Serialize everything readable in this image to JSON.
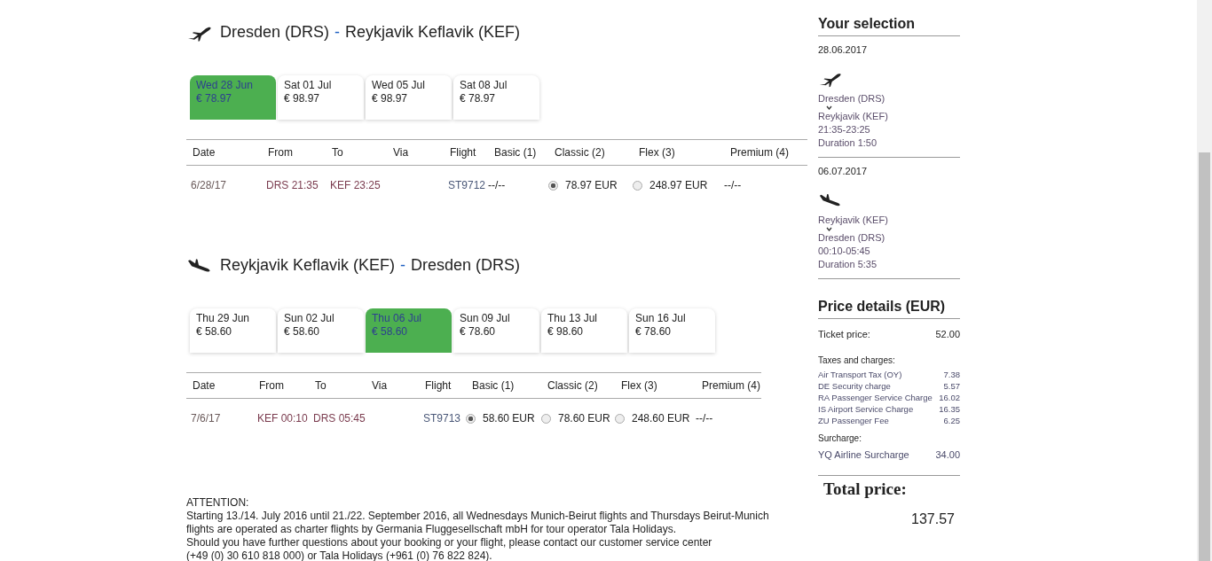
{
  "flights": [
    {
      "kind": "takeoff",
      "title": {
        "from": "Dresden (DRS)",
        "separator": "-",
        "to": "Reykjavik Keflavik (KEF)"
      },
      "dates": [
        {
          "day": "Wed 28 Jun",
          "price": "€ 78.97",
          "selected": true
        },
        {
          "day": "Sat 01 Jul",
          "price": "€ 98.97",
          "selected": false
        },
        {
          "day": "Wed 05 Jul",
          "price": "€ 98.97",
          "selected": false
        },
        {
          "day": "Sat 08 Jul",
          "price": "€ 78.97",
          "selected": false
        }
      ],
      "columns": [
        "Date",
        "From",
        "To",
        "Via",
        "Flight",
        "Basic (1)",
        "Classic (2)",
        "Flex (3)",
        "Premium (4)"
      ],
      "rows": [
        {
          "date": "6/28/17",
          "from": "DRS 21:35",
          "to": "KEF 23:25",
          "flight": "ST9712",
          "fares": [
            {
              "kind": "none",
              "text": "--/--"
            },
            {
              "kind": "radio",
              "price": "78.97 EUR",
              "selected": true
            },
            {
              "kind": "radio",
              "price": "248.97 EUR",
              "selected": false
            },
            {
              "kind": "none",
              "text": "--/--"
            }
          ]
        }
      ]
    },
    {
      "kind": "landing",
      "title": {
        "from": "Reykjavik Keflavik (KEF)",
        "separator": "-",
        "to": "Dresden (DRS)"
      },
      "dates": [
        {
          "day": "Thu 29 Jun",
          "price": "€ 58.60",
          "selected": false
        },
        {
          "day": "Sun 02 Jul",
          "price": "€ 58.60",
          "selected": false
        },
        {
          "day": "Thu 06 Jul",
          "price": "€ 58.60",
          "selected": true
        },
        {
          "day": "Sun 09 Jul",
          "price": "€ 78.60",
          "selected": false
        },
        {
          "day": "Thu 13 Jul",
          "price": "€ 98.60",
          "selected": false
        },
        {
          "day": "Sun 16 Jul",
          "price": "€ 78.60",
          "selected": false
        }
      ],
      "columns": [
        "Date",
        "From",
        "To",
        "Via",
        "Flight",
        "Basic (1)",
        "Classic (2)",
        "Flex (3)",
        "Premium (4)"
      ],
      "rows": [
        {
          "date": "7/6/17",
          "from": "KEF 00:10",
          "to": "DRS 05:45",
          "flight": "ST9713",
          "fares": [
            {
              "kind": "radio",
              "price": "58.60 EUR",
              "selected": true
            },
            {
              "kind": "radio",
              "price": "78.60 EUR",
              "selected": false
            },
            {
              "kind": "radio",
              "price": "248.60 EUR",
              "selected": false
            },
            {
              "kind": "none",
              "text": "--/--"
            }
          ]
        }
      ]
    }
  ],
  "notice": [
    "ATTENTION:",
    "Starting 13./14. July 2016 until 21./22. September 2016, all Wednesdays Munich-Beirut flights and Thursdays Beirut-Munich",
    "flights are operated as charter flights by Germania Fluggesellschaft mbH for tour operator Tala Holidays.",
    "Should you have further questions about your booking or your flight, please contact our customer service center",
    "(+49 (0) 30 610 818 000) or Tala Holidays (+961 (0) 76 822 824)."
  ],
  "selection": {
    "title": "Your selection",
    "legs": [
      {
        "date": "28.06.2017",
        "kind": "takeoff",
        "from": "Dresden (DRS)",
        "to": "Reykjavik (KEF)",
        "times": "21:35-23:25",
        "duration": "Duration 1:50"
      },
      {
        "date": "06.07.2017",
        "kind": "landing",
        "from": "Reykjavik (KEF)",
        "to": "Dresden (DRS)",
        "times": "00:10-05:45",
        "duration": "Duration 5:35"
      }
    ]
  },
  "price_details": {
    "title": "Price details (EUR)",
    "ticket": {
      "label": "Ticket price:",
      "value": "52.00"
    },
    "taxes_heading": "Taxes and charges:",
    "taxes": [
      {
        "label": "Air Transport Tax (OY)",
        "value": "7.38"
      },
      {
        "label": "DE Security charge",
        "value": "5.57"
      },
      {
        "label": "RA Passenger Service Charge",
        "value": "16.02"
      },
      {
        "label": "IS Airport Service Charge",
        "value": "16.35"
      },
      {
        "label": "ZU Passenger Fee",
        "value": "6.25"
      }
    ],
    "surcharge_heading": "Surcharge:",
    "surcharges": [
      {
        "label": "YQ Airline Surcharge",
        "value": "34.00"
      }
    ],
    "total_label": "Total price:",
    "total_value": "137.57"
  }
}
